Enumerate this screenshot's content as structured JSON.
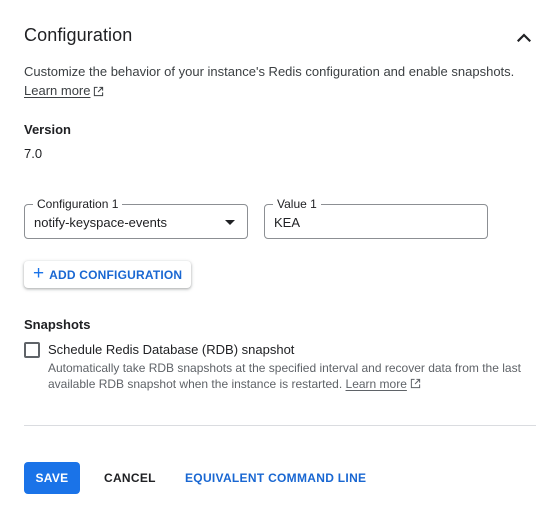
{
  "section": {
    "title": "Configuration",
    "description": "Customize the behavior of your instance's Redis configuration and enable snapshots.",
    "learn_more": "Learn more"
  },
  "version": {
    "label": "Version",
    "value": "7.0"
  },
  "config_row": {
    "config_label": "Configuration 1",
    "config_value": "notify-keyspace-events",
    "value_label": "Value 1",
    "value_value": "KEA"
  },
  "add_configuration": "ADD CONFIGURATION",
  "snapshots": {
    "label": "Snapshots",
    "checkbox_label": "Schedule Redis Database (RDB) snapshot",
    "checked": false,
    "help": "Automatically take RDB snapshots at the specified interval and recover data from the last available RDB snapshot when the instance is restarted.",
    "learn_more": "Learn more"
  },
  "actions": {
    "save": "SAVE",
    "cancel": "CANCEL",
    "equivalent": "EQUIVALENT COMMAND LINE"
  },
  "colors": {
    "primary": "#1a73e8",
    "link_text": "#1967d2",
    "text": "#202124",
    "secondary_text": "#5f6368"
  },
  "icons": [
    "chevron-up-icon",
    "open-in-new-icon",
    "dropdown-arrow-icon",
    "plus-icon"
  ]
}
